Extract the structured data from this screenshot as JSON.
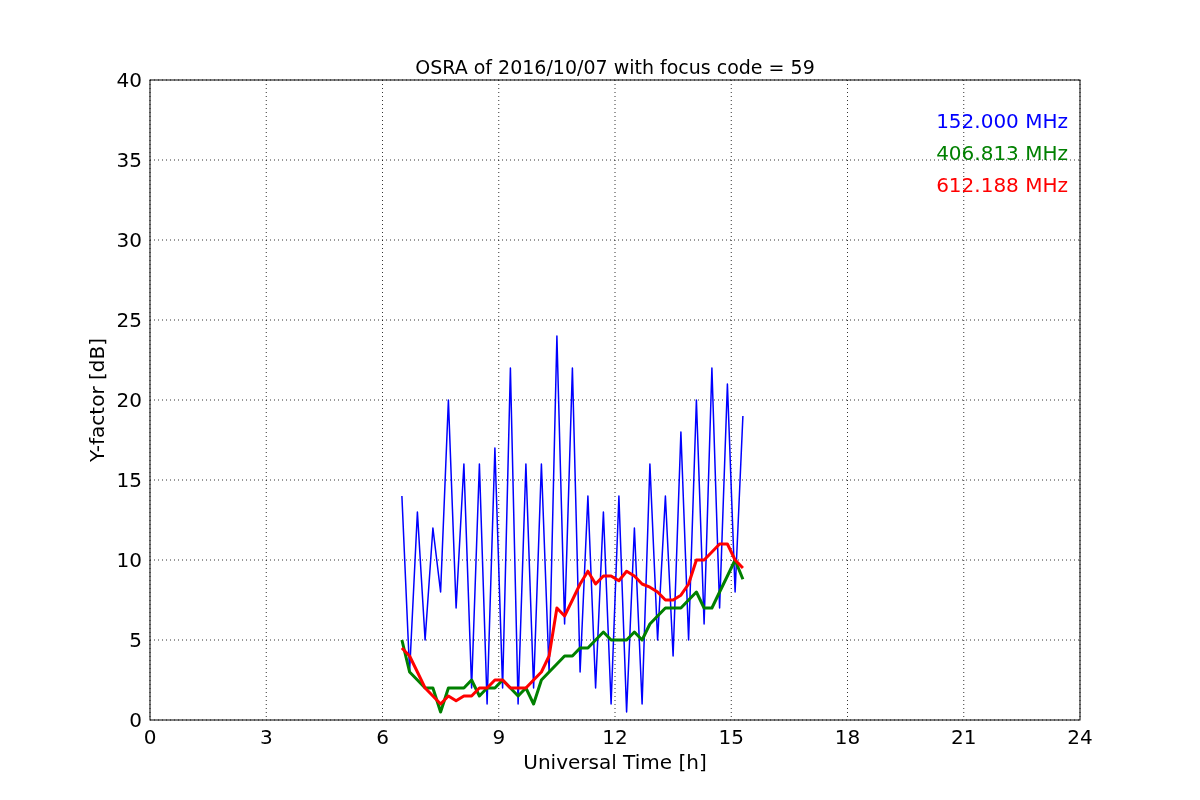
{
  "chart_data": {
    "type": "line",
    "title": "OSRA of 2016/10/07 with focus code = 59",
    "xlabel": "Universal Time [h]",
    "ylabel": "Y-factor [dB]",
    "x": [
      6.5,
      6.7,
      6.9,
      7.1,
      7.3,
      7.5,
      7.7,
      7.9,
      8.1,
      8.3,
      8.5,
      8.7,
      8.9,
      9.1,
      9.3,
      9.5,
      9.7,
      9.9,
      10.1,
      10.3,
      10.5,
      10.7,
      10.9,
      11.1,
      11.3,
      11.5,
      11.7,
      11.9,
      12.1,
      12.3,
      12.5,
      12.7,
      12.9,
      13.1,
      13.3,
      13.5,
      13.7,
      13.9,
      14.1,
      14.3,
      14.5,
      14.7,
      14.9,
      15.1,
      15.3
    ],
    "series": [
      {
        "name": "152.000 MHz",
        "color": "#0000ff",
        "values": [
          14,
          3,
          13,
          5,
          12,
          8,
          20,
          7,
          16,
          2,
          16,
          1,
          17,
          2,
          22,
          1,
          16,
          2,
          16,
          3,
          24,
          6,
          22,
          3,
          14,
          2,
          13,
          1,
          14,
          0.5,
          12,
          1,
          16,
          5,
          14,
          4,
          18,
          5,
          20,
          6,
          22,
          7,
          21,
          8,
          19
        ]
      },
      {
        "name": "406.813 MHz",
        "color": "#008000",
        "values": [
          5,
          3,
          2.5,
          2,
          2,
          0.5,
          2,
          2,
          2,
          2.5,
          1.5,
          2,
          2,
          2.5,
          2,
          1.5,
          2,
          1,
          2.5,
          3,
          3.5,
          4,
          4,
          4.5,
          4.5,
          5,
          5.5,
          5,
          5,
          5,
          5.5,
          5,
          6,
          6.5,
          7,
          7,
          7,
          7.5,
          8,
          7,
          7,
          8,
          9,
          10,
          8.8
        ]
      },
      {
        "name": "612.188 MHz",
        "color": "#ff0000",
        "values": [
          4.5,
          4,
          3,
          2,
          1.5,
          1,
          1.5,
          1.2,
          1.5,
          1.5,
          2,
          2,
          2.5,
          2.5,
          2,
          2,
          2,
          2.5,
          3,
          4,
          7,
          6.5,
          7.5,
          8.5,
          9.3,
          8.5,
          9,
          9,
          8.7,
          9.3,
          9,
          8.5,
          8.3,
          8,
          7.5,
          7.5,
          7.8,
          8.5,
          10,
          10,
          10.5,
          11,
          11,
          10,
          9.5
        ]
      }
    ],
    "xlim": [
      0,
      24
    ],
    "ylim": [
      0,
      40
    ],
    "xticks": [
      0,
      3,
      6,
      9,
      12,
      15,
      18,
      21,
      24
    ],
    "yticks": [
      0,
      5,
      10,
      15,
      20,
      25,
      30,
      35,
      40
    ],
    "grid": true
  }
}
